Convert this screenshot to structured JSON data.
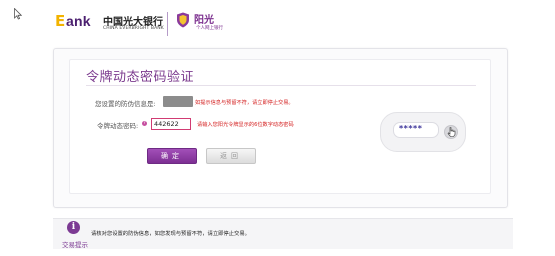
{
  "header": {
    "logo_e": "E",
    "logo_bank": "ank",
    "bank_name_cn": "中国光大银行",
    "bank_name_en": "CHINA EVERBRIGHT BANK",
    "brand_name": "阳光",
    "brand_slogan": "个人网上银行"
  },
  "page": {
    "title": "令牌动态密码验证"
  },
  "form": {
    "security_info_label": "您设置的防伪信息是:",
    "security_warning": "如提示信息与预留不符，请立即停止交易。",
    "otp_label": "令牌动态密码:",
    "help_icon": "?",
    "otp_value": "442622",
    "otp_hint": "请输入您阳光令牌显示的6位数字动态密码"
  },
  "buttons": {
    "confirm": "确定",
    "back": "返回"
  },
  "token": {
    "digits": "*****"
  },
  "tips": {
    "label": "交易提示",
    "text": "请核对您设置的防伪信息，如您发现与预留不符，请立即停止交易。"
  }
}
